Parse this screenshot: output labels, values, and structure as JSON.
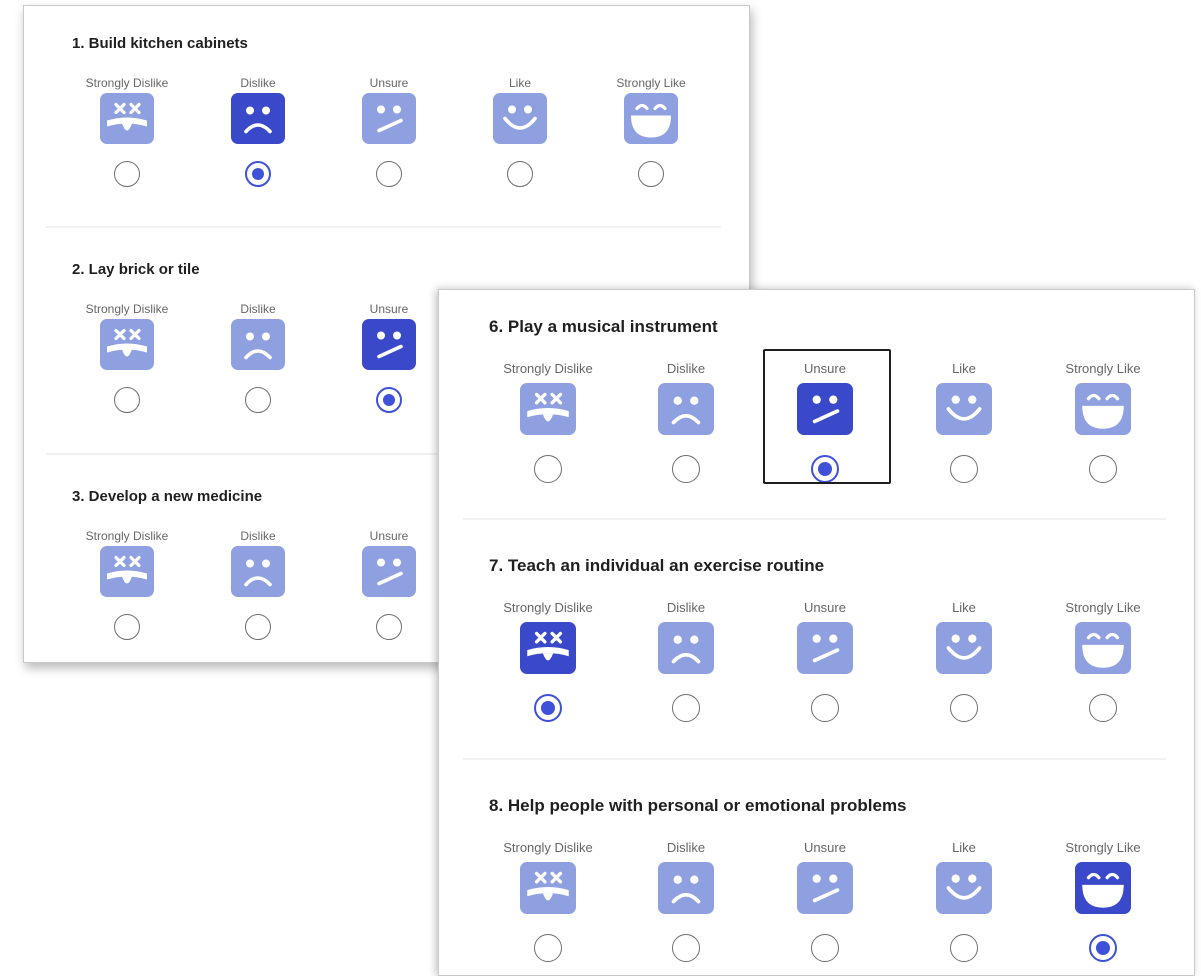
{
  "colors": {
    "face_default": "#8fa0e0",
    "face_selected": "#3949c9",
    "radio_checked": "#3f51d8"
  },
  "scale_options": [
    {
      "label": "Strongly Dislike",
      "icon": "dizzy-face-icon"
    },
    {
      "label": "Dislike",
      "icon": "sad-face-icon"
    },
    {
      "label": "Unsure",
      "icon": "unsure-face-icon"
    },
    {
      "label": "Like",
      "icon": "smile-face-icon"
    },
    {
      "label": "Strongly Like",
      "icon": "laughing-face-icon"
    }
  ],
  "left_card": {
    "questions": [
      {
        "title": "1. Build kitchen cabinets",
        "selected": "Dislike",
        "visible_options": 5
      },
      {
        "title": "2. Lay brick or tile",
        "selected": "Unsure",
        "visible_options": 3
      },
      {
        "title": "3. Develop a new medicine",
        "selected": null,
        "visible_options": 3
      }
    ]
  },
  "right_card": {
    "questions": [
      {
        "title": "6. Play a musical instrument",
        "selected": "Unsure",
        "focused": "Unsure"
      },
      {
        "title": "7. Teach an individual an exercise routine",
        "selected": "Strongly Dislike"
      },
      {
        "title": "8. Help people with personal or emotional problems",
        "selected": "Strongly Like"
      }
    ]
  }
}
